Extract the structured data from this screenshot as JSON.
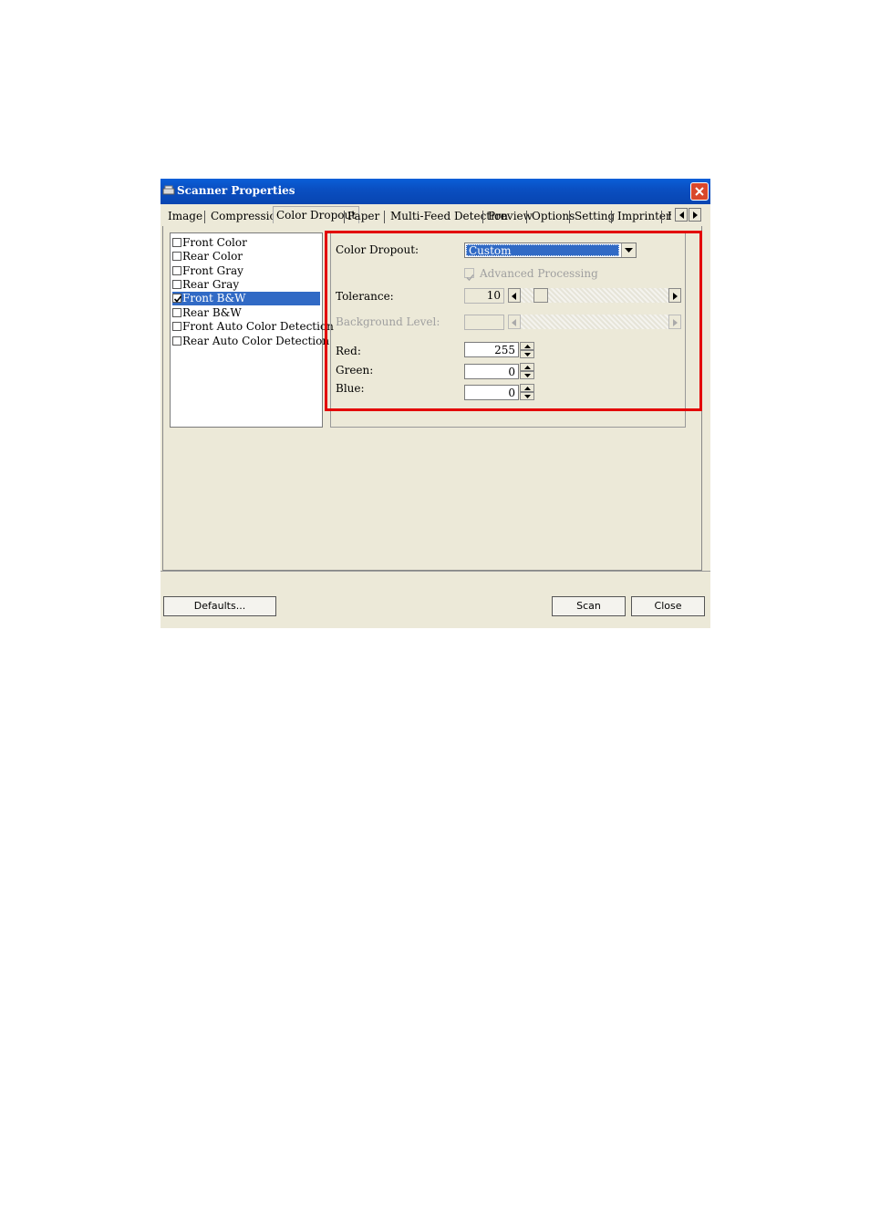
{
  "window": {
    "title": "Scanner Properties"
  },
  "tabs": [
    {
      "label": "Image"
    },
    {
      "label": "Compression"
    },
    {
      "label": "Color Dropout"
    },
    {
      "label": "Paper"
    },
    {
      "label": "Multi-Feed Detection"
    },
    {
      "label": "Preview"
    },
    {
      "label": "Options"
    },
    {
      "label": "Setting"
    },
    {
      "label": "Imprinter"
    },
    {
      "label": "I"
    }
  ],
  "active_tab": "Color Dropout",
  "image_list": [
    {
      "label": "Front Color",
      "checked": false
    },
    {
      "label": "Rear Color",
      "checked": false
    },
    {
      "label": "Front Gray",
      "checked": false
    },
    {
      "label": "Rear Gray",
      "checked": false
    },
    {
      "label": "Front B&W",
      "checked": true
    },
    {
      "label": "Rear B&W",
      "checked": false
    },
    {
      "label": "Front Auto Color Detection",
      "checked": false
    },
    {
      "label": "Rear Auto Color Detection",
      "checked": false
    }
  ],
  "color_dropout": {
    "label": "Color Dropout:",
    "value": "Custom",
    "advanced_processing": "Advanced Processing",
    "advanced_checked": true,
    "tolerance_label": "Tolerance:",
    "tolerance_value": "10",
    "background_label": "Background Level:",
    "background_value": "",
    "red_label": "Red:",
    "red_value": "255",
    "green_label": "Green:",
    "green_value": "0",
    "blue_label": "Blue:",
    "blue_value": "0"
  },
  "buttons": {
    "defaults": "Defaults...",
    "scan": "Scan",
    "close": "Close"
  },
  "colors": {
    "titlebar": "#0a52c8",
    "selection": "#316ac5",
    "highlight_box": "#e30000",
    "face": "#ece9d8"
  }
}
